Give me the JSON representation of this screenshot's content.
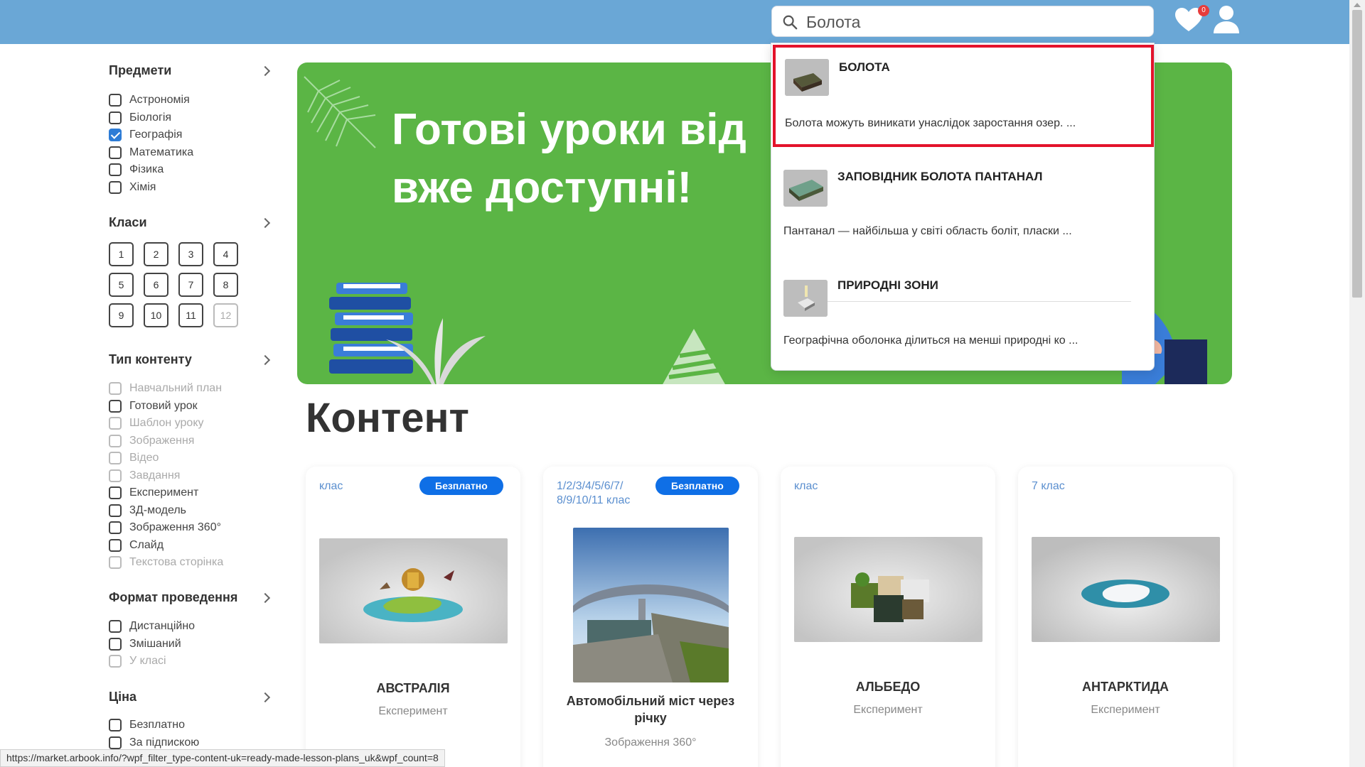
{
  "header": {
    "search_value": "Болота",
    "favorites_count": "0"
  },
  "sidebar": {
    "subjects": {
      "title": "Предмети",
      "items": [
        {
          "label": "Астрономія",
          "checked": false,
          "disabled": false
        },
        {
          "label": "Біологія",
          "checked": false,
          "disabled": false
        },
        {
          "label": "Географія",
          "checked": true,
          "disabled": false
        },
        {
          "label": "Математика",
          "checked": false,
          "disabled": false
        },
        {
          "label": "Фізика",
          "checked": false,
          "disabled": false
        },
        {
          "label": "Хімія",
          "checked": false,
          "disabled": false
        }
      ]
    },
    "grades": {
      "title": "Класи",
      "items": [
        "1",
        "2",
        "3",
        "4",
        "5",
        "6",
        "7",
        "8",
        "9",
        "10",
        "11",
        "12"
      ],
      "disabled": [
        "12"
      ]
    },
    "content_type": {
      "title": "Тип контенту",
      "items": [
        {
          "label": "Навчальний план",
          "checked": false,
          "disabled": true
        },
        {
          "label": "Готовий урок",
          "checked": false,
          "disabled": false
        },
        {
          "label": "Шаблон уроку",
          "checked": false,
          "disabled": true
        },
        {
          "label": "Зображення",
          "checked": false,
          "disabled": true
        },
        {
          "label": "Відео",
          "checked": false,
          "disabled": true
        },
        {
          "label": "Завдання",
          "checked": false,
          "disabled": true
        },
        {
          "label": "Експеримент",
          "checked": false,
          "disabled": false
        },
        {
          "label": "3Д-модель",
          "checked": false,
          "disabled": false
        },
        {
          "label": "Зображення 360°",
          "checked": false,
          "disabled": false
        },
        {
          "label": "Слайд",
          "checked": false,
          "disabled": false
        },
        {
          "label": "Текстова сторінка",
          "checked": false,
          "disabled": true
        }
      ]
    },
    "format": {
      "title": "Формат проведення",
      "items": [
        {
          "label": "Дистанційно",
          "checked": false,
          "disabled": false
        },
        {
          "label": "Змішаний",
          "checked": false,
          "disabled": false
        },
        {
          "label": "У класі",
          "checked": false,
          "disabled": true
        }
      ]
    },
    "price": {
      "title": "Ціна",
      "items": [
        {
          "label": "Безплатно",
          "checked": false,
          "disabled": false
        },
        {
          "label": "За підпискою",
          "checked": false,
          "disabled": false
        }
      ]
    }
  },
  "banner": {
    "line1": "Готові уроки від",
    "line2": "вже доступні!"
  },
  "content": {
    "title": "Контент",
    "cards": [
      {
        "grade": "клас",
        "badge": "Безплатно",
        "title": "АВСТРАЛІЯ",
        "type": "Експеримент",
        "image": "australia-model"
      },
      {
        "grade": "1/2/3/4/5/6/7/\n8/9/10/11 клас",
        "badge": "Безплатно",
        "title": "Автомобільний міст через річку",
        "type": "Зображення 360°",
        "image": "bridge-panorama"
      },
      {
        "grade": "клас",
        "badge": "",
        "title": "АЛЬБЕДО",
        "type": "Експеримент",
        "image": "albedo-blocks"
      },
      {
        "grade": "7 клас",
        "badge": "",
        "title": "АНТАРКТИДА",
        "type": "Експеримент",
        "image": "antarctica-model"
      }
    ]
  },
  "search_results": [
    {
      "title": "БОЛОТА",
      "description": "Болота можуть виникати унаслідок заростання озер. ..."
    },
    {
      "title": "ЗАПОВІДНИК БОЛОТА ПАНТАНАЛ",
      "description": "Пантанал — найбільша у світі область боліт, пласки ..."
    },
    {
      "title": "ПРИРОДНІ ЗОНИ",
      "description": "Географічна оболонка ділиться на менші природні ко ..."
    }
  ],
  "status_bar": {
    "url": "https://market.arbook.info/?wpf_filter_type-content-uk=ready-made-lesson-plans_uk&wpf_count=8"
  },
  "colors": {
    "header": "#6aa7d6",
    "banner": "#5bb545",
    "badge": "#0f6fe6",
    "highlight": "#e3132b",
    "checked": "#2d7cd6"
  }
}
